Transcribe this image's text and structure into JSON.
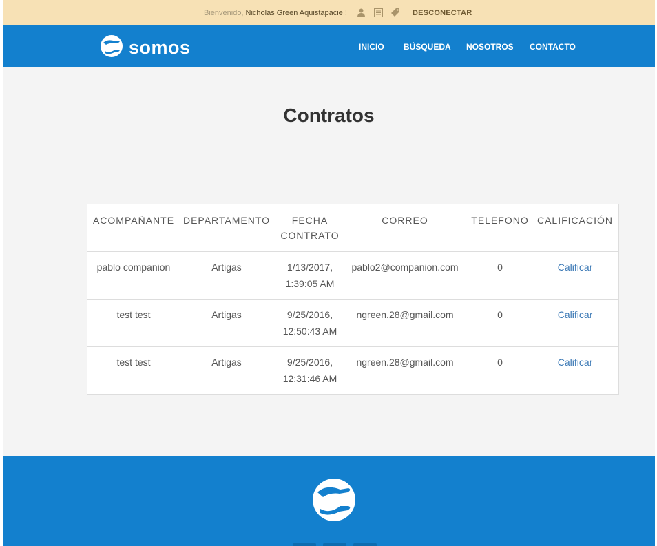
{
  "topbar": {
    "welcome_prefix": "Bienvenido, ",
    "user_name": "Nicholas Green Aquistapacie",
    "welcome_suffix": " !",
    "icons": [
      "user-icon",
      "list-icon",
      "tag-icon"
    ],
    "logout_label": "DESCONECTAR"
  },
  "header": {
    "brand": "somos",
    "nav": [
      "INICIO",
      "BÚSQUEDA",
      "NOSOTROS",
      "CONTACTO"
    ]
  },
  "main": {
    "title": "Contratos",
    "table": {
      "columns": [
        "ACOMPAÑANTE",
        "DEPARTAMENTO",
        "FECHA CONTRATO",
        "CORREO",
        "TELÉFONO",
        "CALIFICACIÓN"
      ],
      "rows": [
        {
          "companion": "pablo companion",
          "department": "Artigas",
          "date": "1/13/2017,",
          "time": "1:39:05 AM",
          "email": "pablo2@companion.com",
          "phone": "0",
          "action": "Calificar"
        },
        {
          "companion": "test test",
          "department": "Artigas",
          "date": "9/25/2016,",
          "time": "12:50:43 AM",
          "email": "ngreen.28@gmail.com",
          "phone": "0",
          "action": "Calificar"
        },
        {
          "companion": "test test",
          "department": "Artigas",
          "date": "9/25/2016,",
          "time": "12:31:46 AM",
          "email": "ngreen.28@gmail.com",
          "phone": "0",
          "action": "Calificar"
        }
      ]
    }
  },
  "colors": {
    "topbar_bg": "#f7e1b5",
    "brand_blue": "#1380ce",
    "page_bg": "#f4f4f4",
    "link": "#3a78b5"
  }
}
